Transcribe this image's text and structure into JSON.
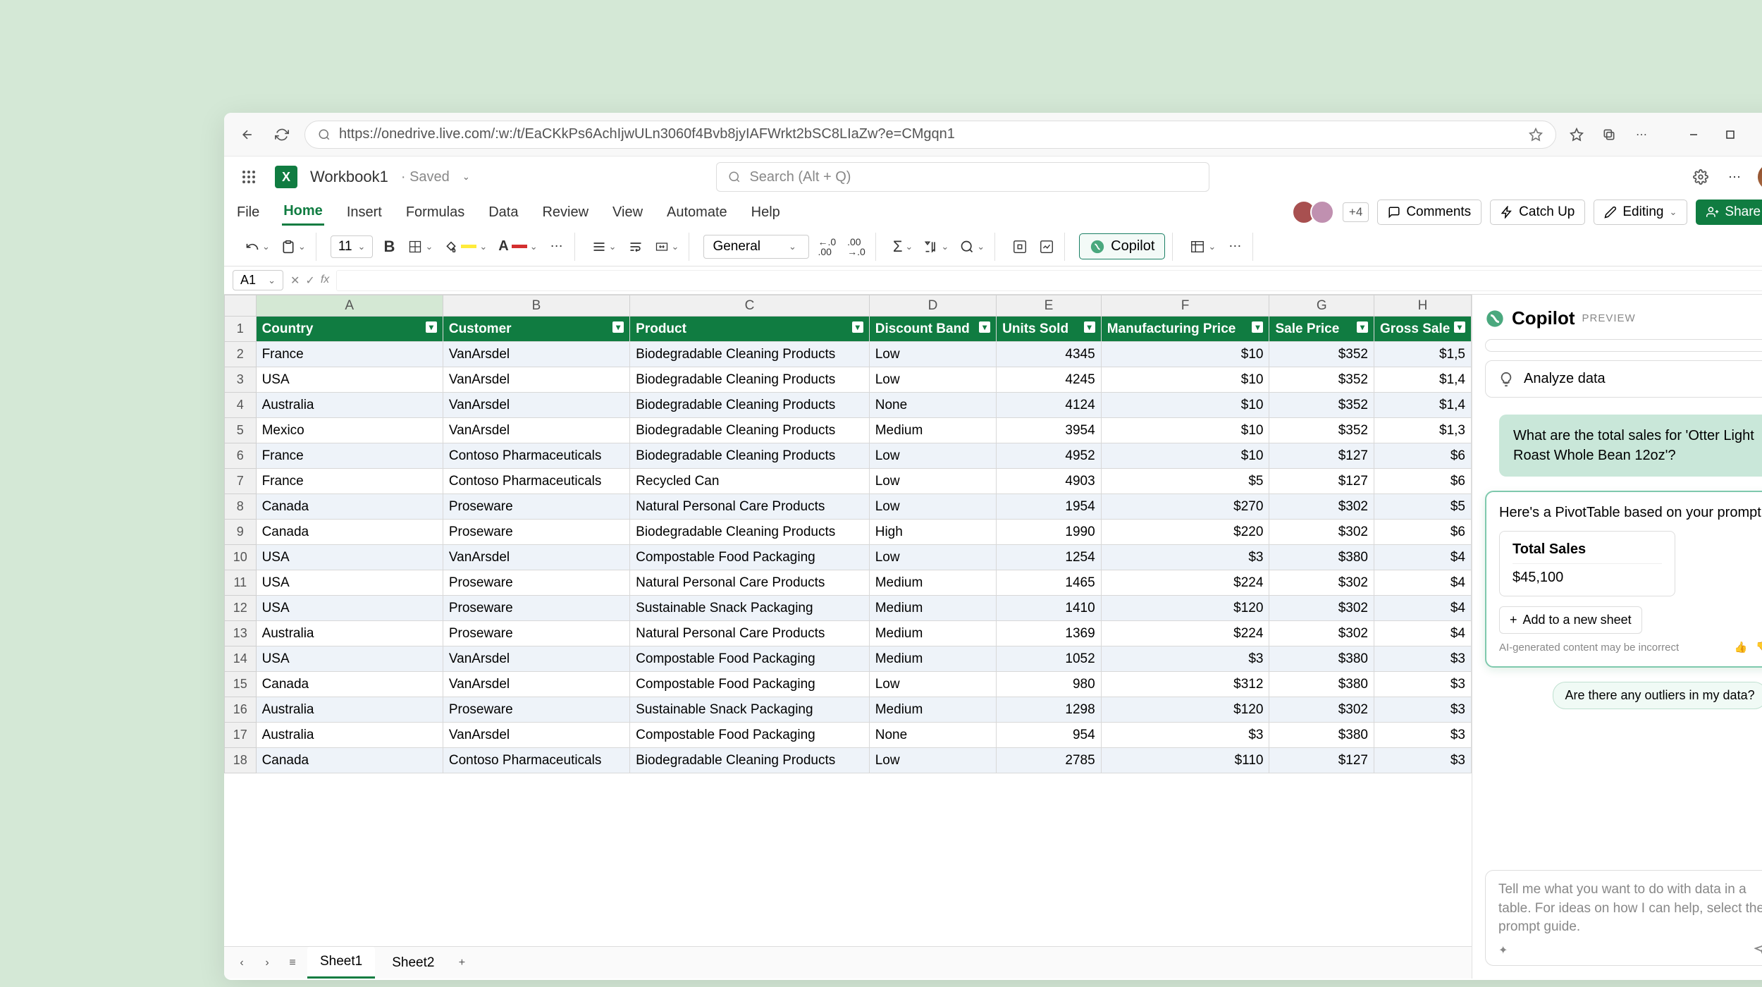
{
  "browser": {
    "url": "https://onedrive.live.com/:w:/t/EaCKkPs6AchIjwULn3060f4Bvb8jyIAFWrkt2bSC8LIaZw?e=CMgqn1"
  },
  "titlebar": {
    "workbook_name": "Workbook1",
    "saved_label": "· Saved",
    "search_placeholder": "Search (Alt + Q)"
  },
  "ribbon": {
    "tabs": [
      "File",
      "Home",
      "Insert",
      "Formulas",
      "Data",
      "Review",
      "View",
      "Automate",
      "Help"
    ],
    "presence_more": "+4",
    "comments": "Comments",
    "catchup": "Catch Up",
    "editing": "Editing",
    "share": "Share"
  },
  "toolbar": {
    "font_size": "11",
    "number_format": "General",
    "copilot": "Copilot"
  },
  "formula_bar": {
    "name_box": "A1"
  },
  "columns": [
    "A",
    "B",
    "C",
    "D",
    "E",
    "F",
    "G",
    "H"
  ],
  "headers": [
    "Country",
    "Customer",
    "Product",
    "Discount Band",
    "Units Sold",
    "Manufacturing Price",
    "Sale Price",
    "Gross Sale"
  ],
  "rows": [
    {
      "n": 2,
      "c": [
        "France",
        "VanArsdel",
        "Biodegradable Cleaning Products",
        "Low",
        "4345",
        "$10",
        "$352",
        "$1,5"
      ]
    },
    {
      "n": 3,
      "c": [
        "USA",
        "VanArsdel",
        "Biodegradable Cleaning Products",
        "Low",
        "4245",
        "$10",
        "$352",
        "$1,4"
      ]
    },
    {
      "n": 4,
      "c": [
        "Australia",
        "VanArsdel",
        "Biodegradable Cleaning Products",
        "None",
        "4124",
        "$10",
        "$352",
        "$1,4"
      ]
    },
    {
      "n": 5,
      "c": [
        "Mexico",
        "VanArsdel",
        "Biodegradable Cleaning Products",
        "Medium",
        "3954",
        "$10",
        "$352",
        "$1,3"
      ]
    },
    {
      "n": 6,
      "c": [
        "France",
        "Contoso Pharmaceuticals",
        "Biodegradable Cleaning Products",
        "Low",
        "4952",
        "$10",
        "$127",
        "$6"
      ]
    },
    {
      "n": 7,
      "c": [
        "France",
        "Contoso Pharmaceuticals",
        "Recycled Can",
        "Low",
        "4903",
        "$5",
        "$127",
        "$6"
      ]
    },
    {
      "n": 8,
      "c": [
        "Canada",
        "Proseware",
        "Natural Personal Care Products",
        "Low",
        "1954",
        "$270",
        "$302",
        "$5"
      ]
    },
    {
      "n": 9,
      "c": [
        "Canada",
        "Proseware",
        "Biodegradable Cleaning Products",
        "High",
        "1990",
        "$220",
        "$302",
        "$6"
      ]
    },
    {
      "n": 10,
      "c": [
        "USA",
        "VanArsdel",
        "Compostable Food Packaging",
        "Low",
        "1254",
        "$3",
        "$380",
        "$4"
      ]
    },
    {
      "n": 11,
      "c": [
        "USA",
        "Proseware",
        "Natural Personal Care Products",
        "Medium",
        "1465",
        "$224",
        "$302",
        "$4"
      ]
    },
    {
      "n": 12,
      "c": [
        "USA",
        "Proseware",
        "Sustainable Snack Packaging",
        "Medium",
        "1410",
        "$120",
        "$302",
        "$4"
      ]
    },
    {
      "n": 13,
      "c": [
        "Australia",
        "Proseware",
        "Natural Personal Care Products",
        "Medium",
        "1369",
        "$224",
        "$302",
        "$4"
      ]
    },
    {
      "n": 14,
      "c": [
        "USA",
        "VanArsdel",
        "Compostable Food Packaging",
        "Medium",
        "1052",
        "$3",
        "$380",
        "$3"
      ]
    },
    {
      "n": 15,
      "c": [
        "Canada",
        "VanArsdel",
        "Compostable Food Packaging",
        "Low",
        "980",
        "$312",
        "$380",
        "$3"
      ]
    },
    {
      "n": 16,
      "c": [
        "Australia",
        "Proseware",
        "Sustainable Snack Packaging",
        "Medium",
        "1298",
        "$120",
        "$302",
        "$3"
      ]
    },
    {
      "n": 17,
      "c": [
        "Australia",
        "VanArsdel",
        "Compostable Food Packaging",
        "None",
        "954",
        "$3",
        "$380",
        "$3"
      ]
    },
    {
      "n": 18,
      "c": [
        "Canada",
        "Contoso Pharmaceuticals",
        "Biodegradable Cleaning Products",
        "Low",
        "2785",
        "$110",
        "$127",
        "$3"
      ]
    }
  ],
  "sheet_tabs": [
    "Sheet1",
    "Sheet2"
  ],
  "copilot": {
    "title": "Copilot",
    "preview": "PREVIEW",
    "analyze": "Analyze data",
    "user_msg": "What are the total sales for 'Otter Light Roast Whole Bean 12oz'?",
    "response_intro": "Here's a PivotTable based on your prompt:",
    "pivot_title": "Total Sales",
    "pivot_value": "$45,100",
    "add_sheet": "Add to a new sheet",
    "disclaimer": "AI-generated content may be incorrect",
    "chip": "Are there any outliers in my data?",
    "input_placeholder": "Tell me what you want to do with data in a table. For ideas on how I can help, select the prompt guide."
  }
}
